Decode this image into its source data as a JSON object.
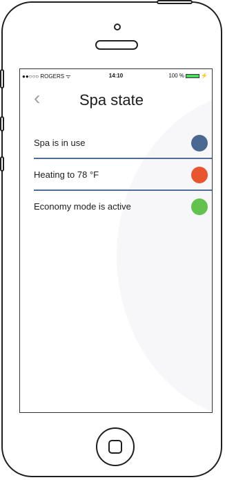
{
  "status": {
    "carrier": "●●○○○ ROGERS ᯤ",
    "time": "14:10",
    "battery_text": "100 %",
    "battery_level": 1.0,
    "charging_symbol": "⚡"
  },
  "nav": {
    "back_symbol": "‹",
    "title": "Spa state"
  },
  "states": [
    {
      "label": "Spa is in use",
      "color": "#4a6892"
    },
    {
      "label": "Heating to 78 °F",
      "color": "#e8552e"
    },
    {
      "label": "Economy mode is active",
      "color": "#63c24e"
    }
  ],
  "colors": {
    "separator": "#4d6f95",
    "battery_fill": "#4cd964"
  },
  "icons": [
    "back-chevron-icon",
    "wifi-icon",
    "battery-icon",
    "home-button-icon"
  ]
}
